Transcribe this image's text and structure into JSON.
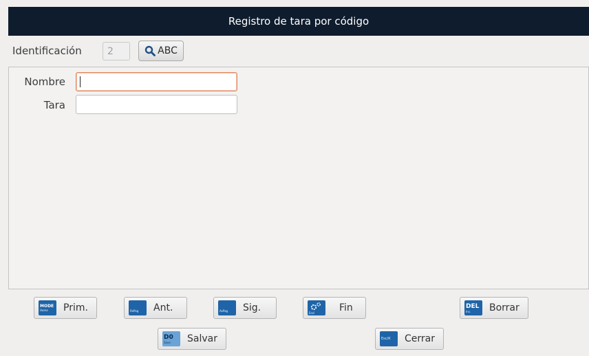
{
  "window": {
    "title": "Registro de tara por código"
  },
  "identification": {
    "label": "Identificación",
    "value": "2",
    "search_button_label": "ABC",
    "search_icon": "magnifier-icon"
  },
  "form": {
    "name_label": "Nombre",
    "name_value": "",
    "tare_label": "Tara",
    "tare_value": ""
  },
  "buttons": {
    "first": {
      "label": "Prim.",
      "key": "MODE",
      "key_sub": "Home"
    },
    "prev": {
      "label": "Ant.",
      "key": "",
      "key_sub": "RePag"
    },
    "next": {
      "label": "Sig.",
      "key": "",
      "key_sub": "AvPag"
    },
    "end": {
      "label": "Fin",
      "key": "",
      "key_sub": "End",
      "icon": "gears-icon"
    },
    "delete": {
      "label": "Borrar",
      "key": "DEL",
      "key_sub": "Ins."
    },
    "save": {
      "label": "Salvar",
      "key": "D0",
      "key_sub": "Save"
    },
    "close": {
      "label": "Cerrar",
      "key": "",
      "key_sub": "Esc/K"
    }
  },
  "colors": {
    "titlebar": "#0f1c2d",
    "key_icon": "#1f64a8",
    "focus_border": "#e0845a"
  }
}
